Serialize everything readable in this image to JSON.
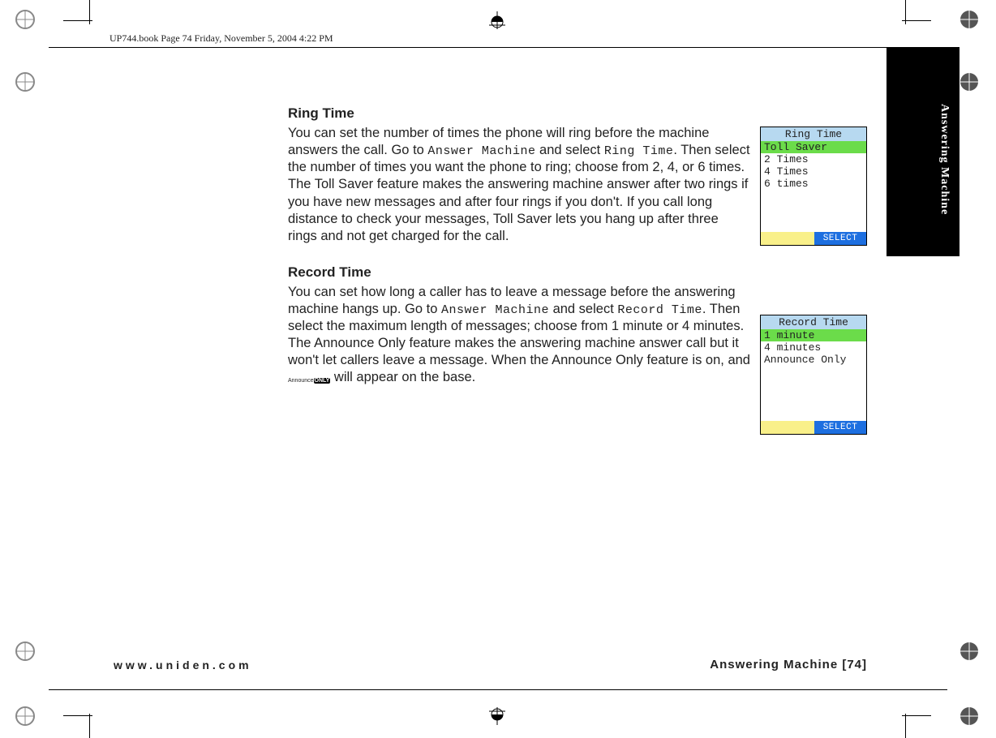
{
  "header": "UP744.book  Page 74  Friday, November 5, 2004  4:22 PM",
  "sideTab": "Answering Machine",
  "section1": {
    "heading": "Ring Time",
    "text_before_mono1": "You can set the number of times the phone will ring before the machine answers the call. Go to ",
    "mono1": "Answer Machine",
    "text_mid1": " and select ",
    "mono2": "Ring Time",
    "text_after": ". Then select the number of times you want the phone to ring; choose from 2, 4, or 6 times. The Toll Saver feature makes the answering machine answer after two rings if you have new messages and after four rings if you don't. If you call long distance to check your messages, Toll Saver lets you hang up after three rings and not get charged for the call."
  },
  "section2": {
    "heading": "Record Time",
    "t1": "You can set how long a caller has to leave a message before the answering machine hangs up. Go to ",
    "m1": "Answer Machine",
    "t2": " and select ",
    "m2": "Record Time",
    "t3": ". Then select the maximum length of messages; choose from 1 minute or 4 minutes. The Announce Only feature makes the answering machine answer call but it won't let callers leave a message. When the Announce Only feature is on, and ",
    "iconTop": "Announce",
    "iconBot": "ONLY",
    "t4": " will appear on the base."
  },
  "lcd1": {
    "title": "Ring Time",
    "selected": "Toll Saver",
    "rows": [
      "2 Times",
      "4 Times",
      "6 times"
    ],
    "button": "SELECT"
  },
  "lcd2": {
    "title": "Record Time",
    "selected": "1 minute",
    "rows": [
      "4 minutes",
      "Announce Only"
    ],
    "button": "SELECT"
  },
  "footer": {
    "left": "www.uniden.com",
    "right": "Answering Machine [74]"
  }
}
